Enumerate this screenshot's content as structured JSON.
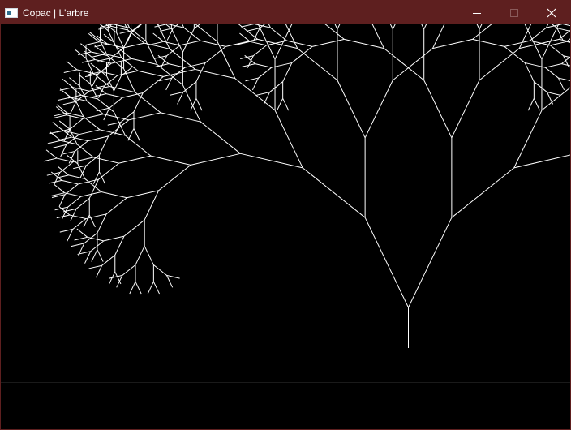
{
  "window": {
    "title": "Copac | L'arbre",
    "accent_color": "#5e1f1f",
    "controls": [
      {
        "name": "minimize",
        "icon": "minimize-icon"
      },
      {
        "name": "maximize",
        "icon": "maximize-icon",
        "enabled": false
      },
      {
        "name": "close",
        "icon": "close-icon"
      }
    ]
  },
  "canvas": {
    "background": "#000000",
    "stroke_color": "#ffffff",
    "drawings": [
      {
        "name": "stump-line",
        "kind": "single-line"
      },
      {
        "name": "fractal-tree",
        "kind": "binary-tree"
      }
    ]
  }
}
